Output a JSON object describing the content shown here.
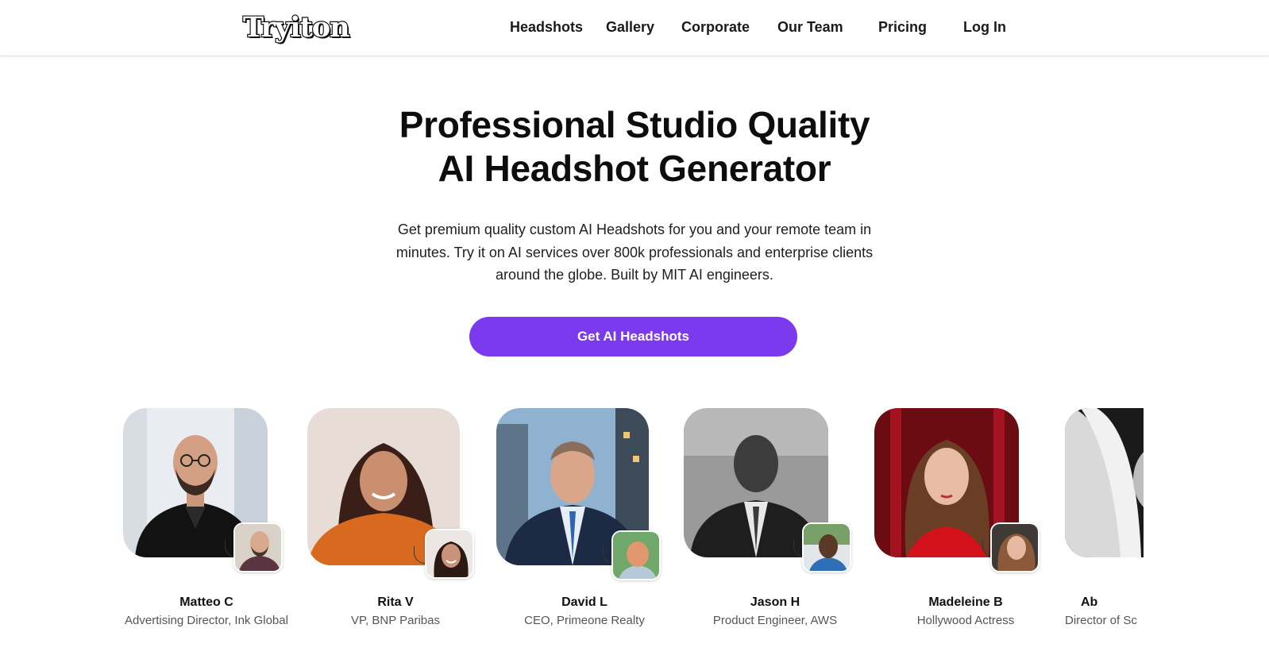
{
  "nav": {
    "logo": "Tryiton",
    "links": [
      "Headshots",
      "Gallery",
      "Corporate",
      "Our Team",
      "Pricing",
      "Log In"
    ]
  },
  "hero": {
    "title_line1": "Professional Studio Quality",
    "title_line2": "AI Headshot Generator",
    "subtitle_line1": "Get premium quality custom AI Headshots for you and your remote team in",
    "subtitle_line2": "minutes. Try it on AI services over 800k professionals and enterprise clients",
    "subtitle_line3": "around the globe. Built by MIT AI engineers.",
    "cta_label": "Get AI Headshots"
  },
  "testimonials": [
    {
      "name": "Matteo C",
      "role": "Advertising Director, Ink Global"
    },
    {
      "name": "Rita V",
      "role": "VP, BNP Paribas"
    },
    {
      "name": "David L",
      "role": "CEO, Primeone Realty"
    },
    {
      "name": "Jason H",
      "role": "Product Engineer, AWS"
    },
    {
      "name": "Madeleine B",
      "role": "Hollywood Actress"
    },
    {
      "name": "Ab",
      "role": "Director of Sc"
    }
  ],
  "colors": {
    "accent": "#7b3aed",
    "text": "#111111",
    "muted": "#555555"
  }
}
